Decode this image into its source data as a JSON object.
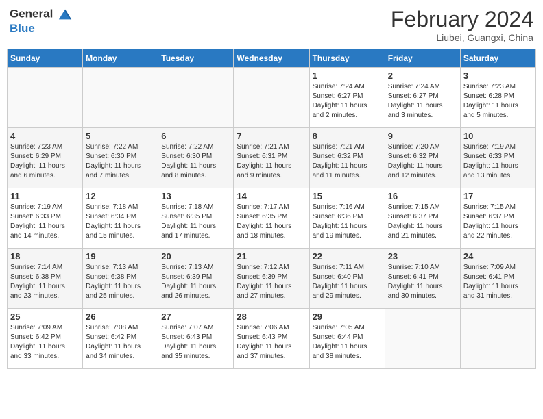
{
  "logo": {
    "line1": "General",
    "line2": "Blue"
  },
  "header": {
    "month_year": "February 2024",
    "location": "Liubei, Guangxi, China"
  },
  "days_of_week": [
    "Sunday",
    "Monday",
    "Tuesday",
    "Wednesday",
    "Thursday",
    "Friday",
    "Saturday"
  ],
  "weeks": [
    [
      {
        "day": "",
        "info": ""
      },
      {
        "day": "",
        "info": ""
      },
      {
        "day": "",
        "info": ""
      },
      {
        "day": "",
        "info": ""
      },
      {
        "day": "1",
        "info": "Sunrise: 7:24 AM\nSunset: 6:27 PM\nDaylight: 11 hours\nand 2 minutes."
      },
      {
        "day": "2",
        "info": "Sunrise: 7:24 AM\nSunset: 6:27 PM\nDaylight: 11 hours\nand 3 minutes."
      },
      {
        "day": "3",
        "info": "Sunrise: 7:23 AM\nSunset: 6:28 PM\nDaylight: 11 hours\nand 5 minutes."
      }
    ],
    [
      {
        "day": "4",
        "info": "Sunrise: 7:23 AM\nSunset: 6:29 PM\nDaylight: 11 hours\nand 6 minutes."
      },
      {
        "day": "5",
        "info": "Sunrise: 7:22 AM\nSunset: 6:30 PM\nDaylight: 11 hours\nand 7 minutes."
      },
      {
        "day": "6",
        "info": "Sunrise: 7:22 AM\nSunset: 6:30 PM\nDaylight: 11 hours\nand 8 minutes."
      },
      {
        "day": "7",
        "info": "Sunrise: 7:21 AM\nSunset: 6:31 PM\nDaylight: 11 hours\nand 9 minutes."
      },
      {
        "day": "8",
        "info": "Sunrise: 7:21 AM\nSunset: 6:32 PM\nDaylight: 11 hours\nand 11 minutes."
      },
      {
        "day": "9",
        "info": "Sunrise: 7:20 AM\nSunset: 6:32 PM\nDaylight: 11 hours\nand 12 minutes."
      },
      {
        "day": "10",
        "info": "Sunrise: 7:19 AM\nSunset: 6:33 PM\nDaylight: 11 hours\nand 13 minutes."
      }
    ],
    [
      {
        "day": "11",
        "info": "Sunrise: 7:19 AM\nSunset: 6:33 PM\nDaylight: 11 hours\nand 14 minutes."
      },
      {
        "day": "12",
        "info": "Sunrise: 7:18 AM\nSunset: 6:34 PM\nDaylight: 11 hours\nand 15 minutes."
      },
      {
        "day": "13",
        "info": "Sunrise: 7:18 AM\nSunset: 6:35 PM\nDaylight: 11 hours\nand 17 minutes."
      },
      {
        "day": "14",
        "info": "Sunrise: 7:17 AM\nSunset: 6:35 PM\nDaylight: 11 hours\nand 18 minutes."
      },
      {
        "day": "15",
        "info": "Sunrise: 7:16 AM\nSunset: 6:36 PM\nDaylight: 11 hours\nand 19 minutes."
      },
      {
        "day": "16",
        "info": "Sunrise: 7:15 AM\nSunset: 6:37 PM\nDaylight: 11 hours\nand 21 minutes."
      },
      {
        "day": "17",
        "info": "Sunrise: 7:15 AM\nSunset: 6:37 PM\nDaylight: 11 hours\nand 22 minutes."
      }
    ],
    [
      {
        "day": "18",
        "info": "Sunrise: 7:14 AM\nSunset: 6:38 PM\nDaylight: 11 hours\nand 23 minutes."
      },
      {
        "day": "19",
        "info": "Sunrise: 7:13 AM\nSunset: 6:38 PM\nDaylight: 11 hours\nand 25 minutes."
      },
      {
        "day": "20",
        "info": "Sunrise: 7:13 AM\nSunset: 6:39 PM\nDaylight: 11 hours\nand 26 minutes."
      },
      {
        "day": "21",
        "info": "Sunrise: 7:12 AM\nSunset: 6:39 PM\nDaylight: 11 hours\nand 27 minutes."
      },
      {
        "day": "22",
        "info": "Sunrise: 7:11 AM\nSunset: 6:40 PM\nDaylight: 11 hours\nand 29 minutes."
      },
      {
        "day": "23",
        "info": "Sunrise: 7:10 AM\nSunset: 6:41 PM\nDaylight: 11 hours\nand 30 minutes."
      },
      {
        "day": "24",
        "info": "Sunrise: 7:09 AM\nSunset: 6:41 PM\nDaylight: 11 hours\nand 31 minutes."
      }
    ],
    [
      {
        "day": "25",
        "info": "Sunrise: 7:09 AM\nSunset: 6:42 PM\nDaylight: 11 hours\nand 33 minutes."
      },
      {
        "day": "26",
        "info": "Sunrise: 7:08 AM\nSunset: 6:42 PM\nDaylight: 11 hours\nand 34 minutes."
      },
      {
        "day": "27",
        "info": "Sunrise: 7:07 AM\nSunset: 6:43 PM\nDaylight: 11 hours\nand 35 minutes."
      },
      {
        "day": "28",
        "info": "Sunrise: 7:06 AM\nSunset: 6:43 PM\nDaylight: 11 hours\nand 37 minutes."
      },
      {
        "day": "29",
        "info": "Sunrise: 7:05 AM\nSunset: 6:44 PM\nDaylight: 11 hours\nand 38 minutes."
      },
      {
        "day": "",
        "info": ""
      },
      {
        "day": "",
        "info": ""
      }
    ]
  ]
}
